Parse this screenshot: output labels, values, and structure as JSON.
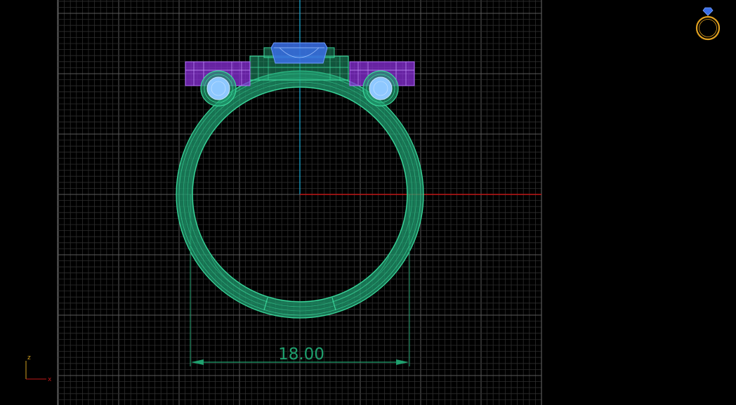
{
  "viewport": {
    "projection": "front",
    "grid": true,
    "background": "#000000"
  },
  "dimension": {
    "label": "18.00"
  },
  "axis_indicator": {
    "vertical_label": "z",
    "horizontal_label": "x"
  },
  "colors": {
    "grid_minor": "#2e2e2e",
    "grid_major": "#5a5a5a",
    "x_axis": "#c01818",
    "z_axis": "#1aa0c8",
    "ring_band": "#1f9a6e",
    "ring_line": "#3ad69a",
    "purple_stones": "#8a2fd8",
    "blue_stone": "#3a6ee8",
    "round_stones": "#8ec8ff",
    "dimension": "#1fa06e",
    "view_cube": "#e0a020"
  },
  "icons": {
    "view_cube": "ring-view-icon",
    "axis_indicator": "axis-triad-icon"
  }
}
